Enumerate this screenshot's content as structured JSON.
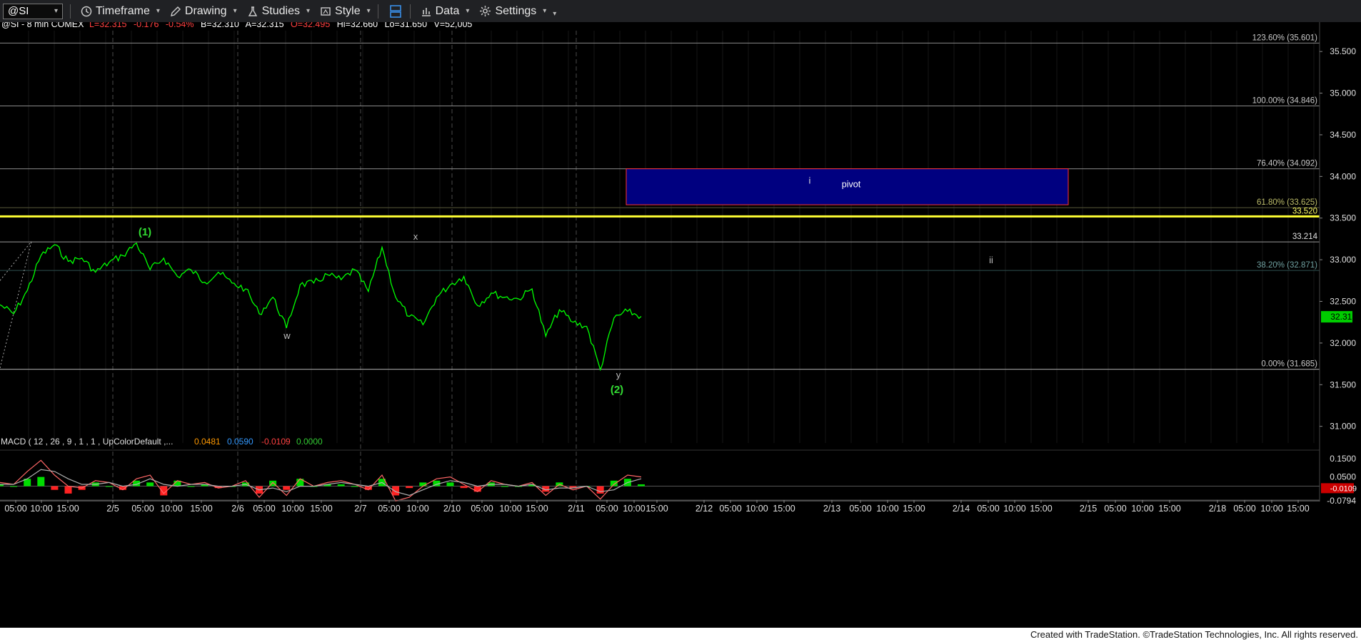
{
  "toolbar": {
    "symbol": "@SI",
    "timeframe": "Timeframe",
    "drawing": "Drawing",
    "studies": "Studies",
    "style": "Style",
    "data": "Data",
    "settings": "Settings"
  },
  "header": {
    "title": "@SI - 8 min  COMEX",
    "last": "L=32.315",
    "change": "-0.176",
    "change_pct": "-0.54%",
    "bid": "B=32.310",
    "ask": "A=32.315",
    "open": "O=32.495",
    "high": "Hi=32.660",
    "low": "Lo=31.650",
    "volume": "V=52,005"
  },
  "colors": {
    "background": "#000000",
    "price_line": "#00ff00",
    "wave_label": "#33dd33",
    "fib_line": "#8a8a8a",
    "highlight_line": "#ffff33",
    "pivot_box": "#000080",
    "pivot_border": "#ff3333",
    "macd_line": "#ff6666",
    "signal_line": "#b0b0b0"
  },
  "chart_data": {
    "type": "line",
    "symbol": "@SI",
    "interval": "8 min",
    "y_ticks": [
      "35.500",
      "35.000",
      "34.500",
      "34.000",
      "33.500",
      "33.000",
      "32.500",
      "32.000",
      "31.500",
      "31.000"
    ],
    "ylim": [
      30.8,
      35.75
    ],
    "x_tick_labels": [
      "05:00",
      "10:00",
      "15:00",
      "2/5",
      "05:00",
      "10:00",
      "15:00",
      "2/6",
      "05:00",
      "10:00",
      "15:00",
      "2/7",
      "05:00",
      "10:00",
      "2/10",
      "05:00",
      "10:00",
      "15:00",
      "2/11",
      "05:00",
      "10:00",
      "15:00",
      "2/12",
      "05:00",
      "10:00",
      "15:00",
      "2/13",
      "05:00",
      "10:00",
      "15:00",
      "2/14",
      "05:00",
      "10:00",
      "15:00",
      "2/15",
      "05:00",
      "10:00",
      "15:00",
      "2/18",
      "05:00",
      "10:00",
      "15:00"
    ],
    "grid": true,
    "price_series": [
      {
        "x": 0,
        "y": 32.46
      },
      {
        "x": 1,
        "y": 32.35
      },
      {
        "x": 2,
        "y": 32.63
      },
      {
        "x": 3,
        "y": 33.05
      },
      {
        "x": 4,
        "y": 33.18
      },
      {
        "x": 5,
        "y": 32.98
      },
      {
        "x": 6,
        "y": 33.02
      },
      {
        "x": 7,
        "y": 32.85
      },
      {
        "x": 8,
        "y": 32.97
      },
      {
        "x": 9,
        "y": 33.05
      },
      {
        "x": 10,
        "y": 33.2
      },
      {
        "x": 11,
        "y": 32.88
      },
      {
        "x": 12,
        "y": 33.02
      },
      {
        "x": 13,
        "y": 32.8
      },
      {
        "x": 14,
        "y": 32.88
      },
      {
        "x": 15,
        "y": 32.73
      },
      {
        "x": 16,
        "y": 32.85
      },
      {
        "x": 17,
        "y": 32.72
      },
      {
        "x": 18,
        "y": 32.65
      },
      {
        "x": 19,
        "y": 32.35
      },
      {
        "x": 20,
        "y": 32.55
      },
      {
        "x": 21,
        "y": 32.18
      },
      {
        "x": 22,
        "y": 32.7
      },
      {
        "x": 23,
        "y": 32.72
      },
      {
        "x": 24,
        "y": 32.82
      },
      {
        "x": 25,
        "y": 32.76
      },
      {
        "x": 26,
        "y": 32.88
      },
      {
        "x": 27,
        "y": 32.62
      },
      {
        "x": 28,
        "y": 33.15
      },
      {
        "x": 29,
        "y": 32.55
      },
      {
        "x": 30,
        "y": 32.32
      },
      {
        "x": 31,
        "y": 32.22
      },
      {
        "x": 32,
        "y": 32.55
      },
      {
        "x": 33,
        "y": 32.7
      },
      {
        "x": 34,
        "y": 32.8
      },
      {
        "x": 35,
        "y": 32.45
      },
      {
        "x": 36,
        "y": 32.6
      },
      {
        "x": 37,
        "y": 32.55
      },
      {
        "x": 38,
        "y": 32.53
      },
      {
        "x": 39,
        "y": 32.65
      },
      {
        "x": 40,
        "y": 32.08
      },
      {
        "x": 41,
        "y": 32.4
      },
      {
        "x": 42,
        "y": 32.25
      },
      {
        "x": 43,
        "y": 32.2
      },
      {
        "x": 44,
        "y": 31.68
      },
      {
        "x": 45,
        "y": 32.3
      },
      {
        "x": 46,
        "y": 32.38
      },
      {
        "x": 47,
        "y": 32.32
      }
    ],
    "fib_levels": [
      {
        "label": "123.60% (35.601)",
        "value": 35.601
      },
      {
        "label": "100.00% (34.846)",
        "value": 34.846
      },
      {
        "label": "76.40% (34.092)",
        "value": 34.092
      },
      {
        "label": "61.80% (33.625)",
        "value": 33.625
      },
      {
        "label": "38.20% (32.871)",
        "value": 32.871
      },
      {
        "label": "0.00% (31.685)",
        "value": 31.685
      }
    ],
    "horizontal_lines": [
      {
        "label": "33.520",
        "value": 33.52,
        "color": "#ffff33"
      },
      {
        "label": "33.214",
        "value": 33.214,
        "color": "#9a9a9a"
      },
      {
        "label": "31.685",
        "value": 31.685,
        "color": "#9a9a9a"
      }
    ],
    "last_price_label": "32.315",
    "pivot_box": {
      "label": "pivot",
      "inner_label": "i",
      "y_top": 34.092,
      "y_bottom": 33.66
    },
    "wave_labels": [
      {
        "text": "(1)",
        "value": 33.29,
        "color": "#33dd33"
      },
      {
        "text": "x",
        "value": 33.24,
        "color": "#bbbbbb"
      },
      {
        "text": "w",
        "value": 32.05,
        "color": "#bbbbbb"
      },
      {
        "text": "y",
        "value": 31.58,
        "color": "#bbbbbb"
      },
      {
        "text": "(2)",
        "value": 31.4,
        "color": "#33dd33"
      },
      {
        "text": "ii",
        "value": 32.96,
        "color": "#bbbbbb"
      }
    ],
    "macd": {
      "label": "MACD ( 12 , 26 , 9 , 1 , 1 , UpColorDefault ,...",
      "values": [
        "0.0481",
        "0.0590",
        "-0.0109",
        "0.0000"
      ],
      "y_ticks": [
        "0.1500",
        "0.0500",
        "-0.0794"
      ],
      "current_label": "-0.0109",
      "ylim": [
        -0.11,
        0.18
      ],
      "macd_series": [
        0.02,
        0.01,
        0.08,
        0.14,
        0.06,
        0.0,
        -0.01,
        0.03,
        0.02,
        -0.02,
        0.04,
        0.06,
        -0.04,
        0.03,
        0.01,
        0.02,
        -0.01,
        0.0,
        0.03,
        -0.06,
        0.02,
        -0.05,
        0.04,
        0.0,
        0.02,
        0.03,
        0.01,
        -0.02,
        0.06,
        -0.08,
        -0.06,
        0.0,
        0.04,
        0.05,
        0.01,
        -0.03,
        0.03,
        0.01,
        0.0,
        0.02,
        -0.05,
        0.01,
        -0.02,
        0.0,
        -0.07,
        0.01,
        0.06,
        0.05
      ],
      "signal_series": [
        0.01,
        0.01,
        0.04,
        0.09,
        0.08,
        0.04,
        0.01,
        0.01,
        0.02,
        0.0,
        0.01,
        0.04,
        0.01,
        0.0,
        0.01,
        0.01,
        0.0,
        0.0,
        0.01,
        -0.02,
        -0.01,
        -0.03,
        0.0,
        0.0,
        0.01,
        0.02,
        0.01,
        0.0,
        0.02,
        -0.03,
        -0.05,
        -0.02,
        0.01,
        0.03,
        0.02,
        0.0,
        0.01,
        0.01,
        0.0,
        0.01,
        -0.02,
        -0.01,
        -0.01,
        0.0,
        -0.03,
        -0.02,
        0.02,
        0.04
      ]
    }
  },
  "footer": {
    "text": "Created with TradeStation. ©TradeStation Technologies, Inc. All rights reserved."
  }
}
